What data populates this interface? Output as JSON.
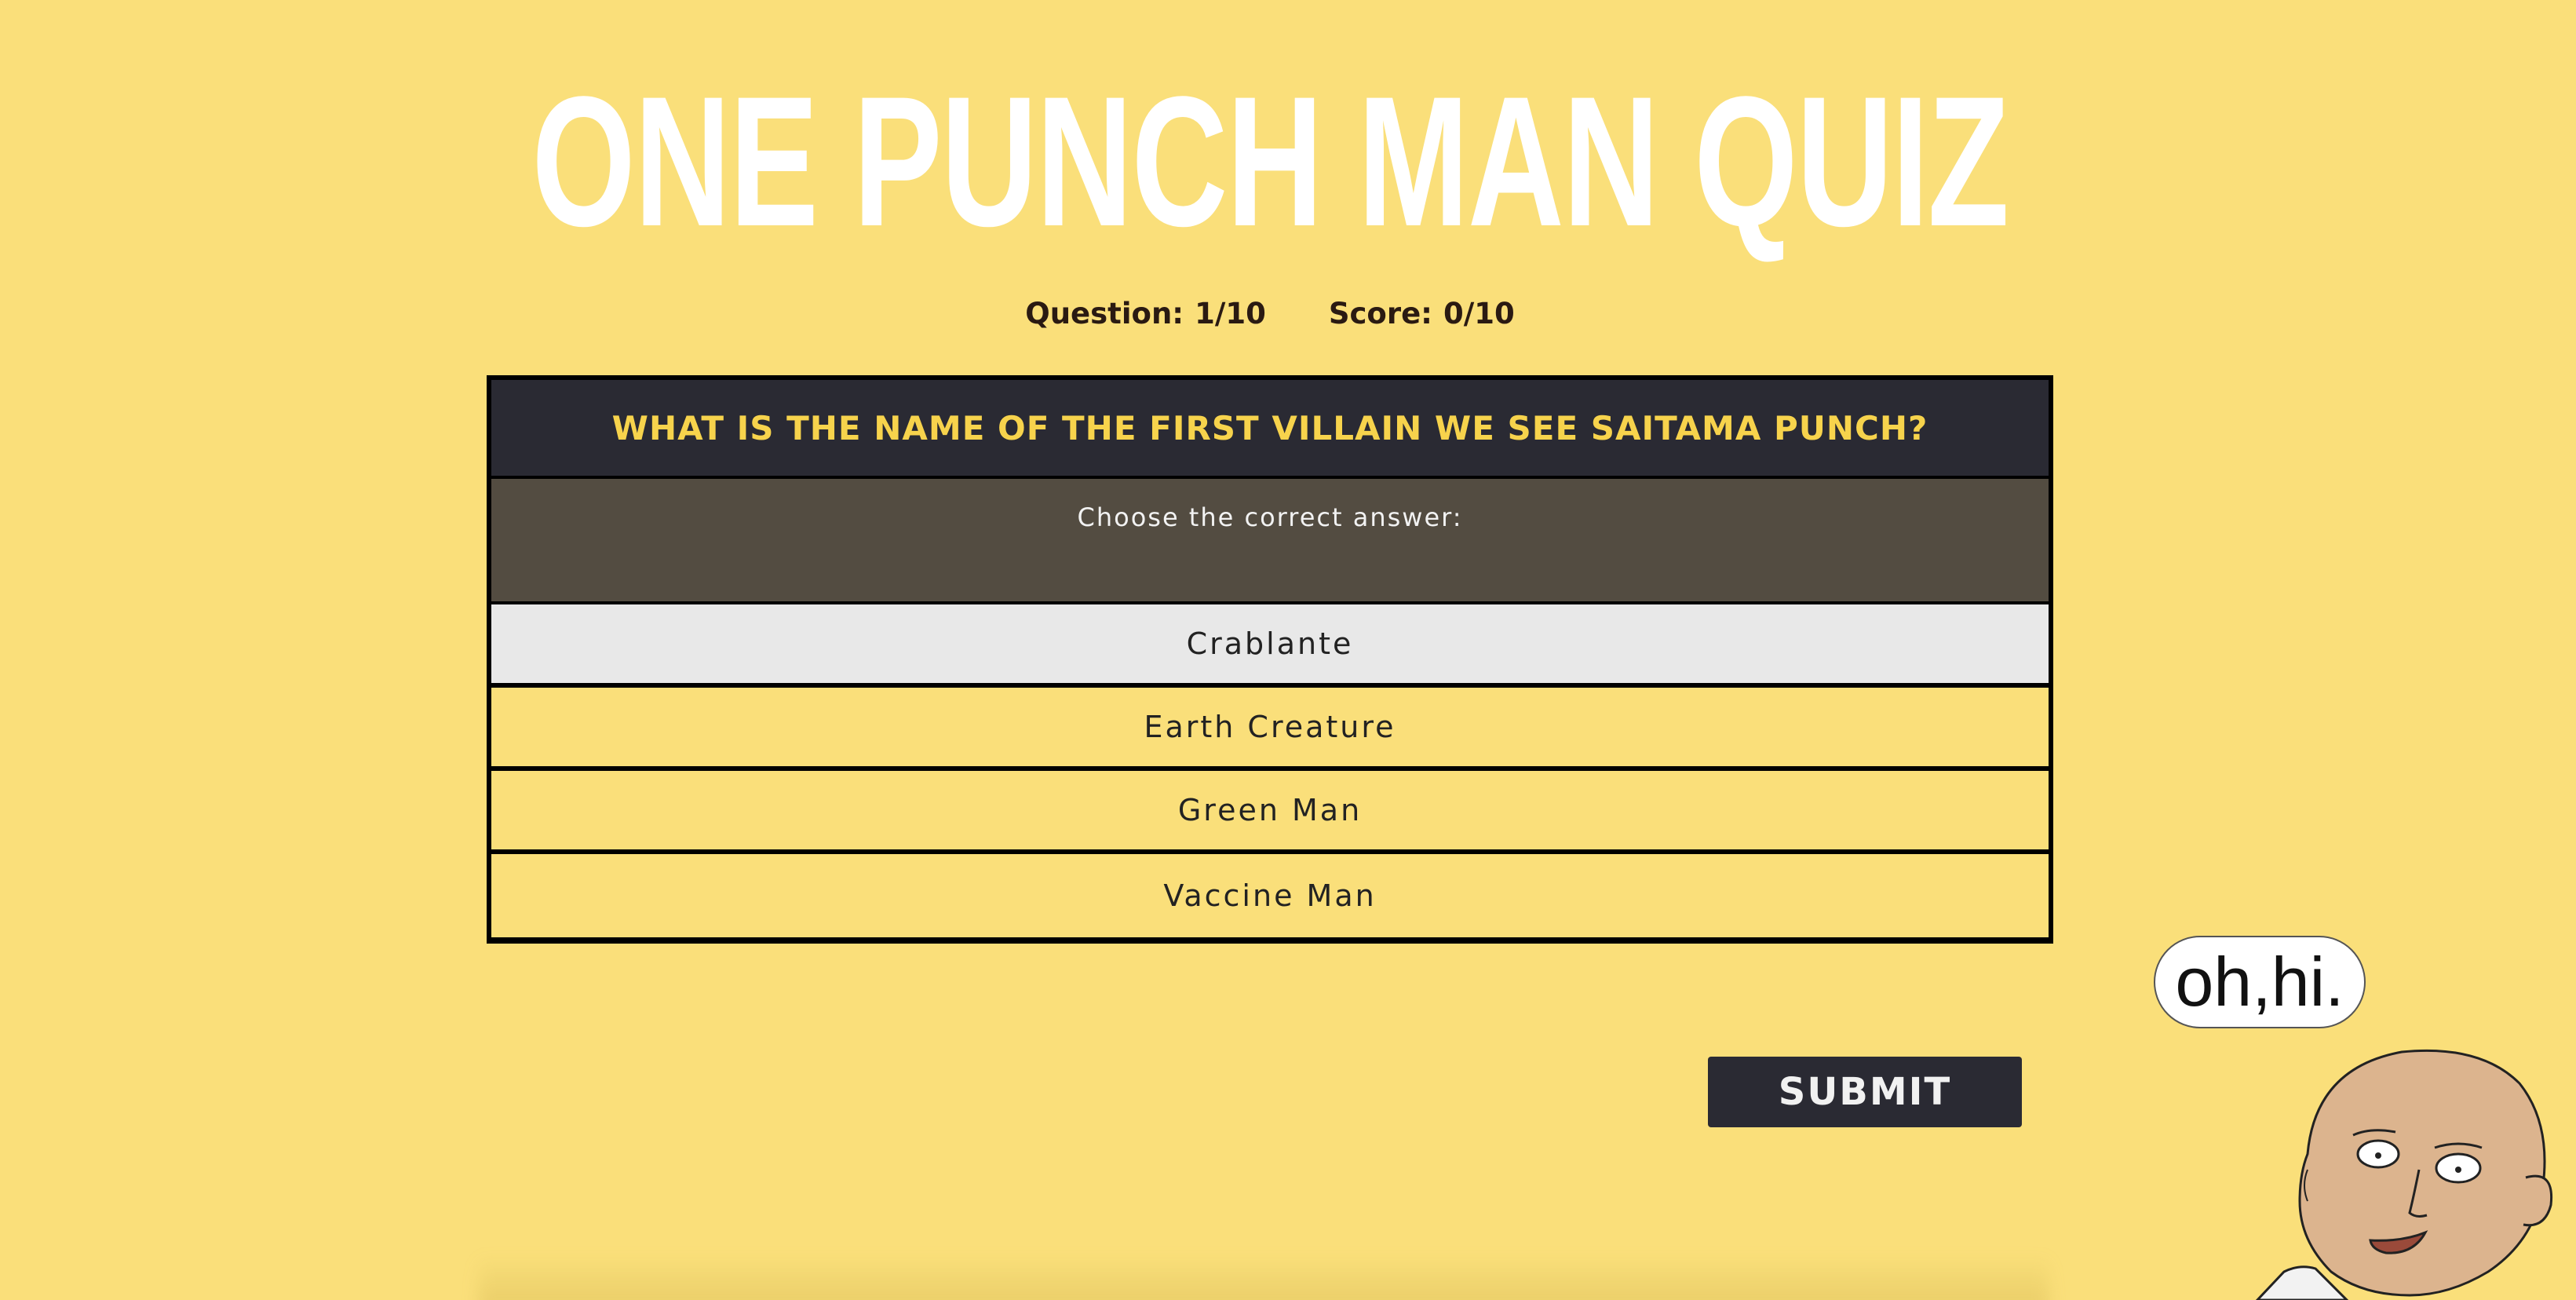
{
  "title": "ONE PUNCH MAN QUIZ",
  "stats": {
    "question_label": "Question:",
    "question_value": "1/10",
    "score_label": "Score:",
    "score_value": "0/10"
  },
  "quiz": {
    "question": "WHAT IS THE NAME OF THE FIRST VILLAIN WE SEE SAITAMA PUNCH?",
    "instruction": "Choose the correct answer:",
    "options": [
      "Crablante",
      "Earth Creature",
      "Green Man",
      "Vaccine Man"
    ],
    "selected_option": "Crablante"
  },
  "submit_label": "SUBMIT",
  "speech_bubble": "oh,hi.",
  "colors": {
    "background": "#fadf7a",
    "dark": "#2a2a33",
    "accent_text": "#f7d34c",
    "instruction_panel": "#534c41",
    "selected_option": "#e8e8e8"
  },
  "icons": {
    "mascot": "saitama-character-icon",
    "bubble": "speech-bubble-icon"
  }
}
